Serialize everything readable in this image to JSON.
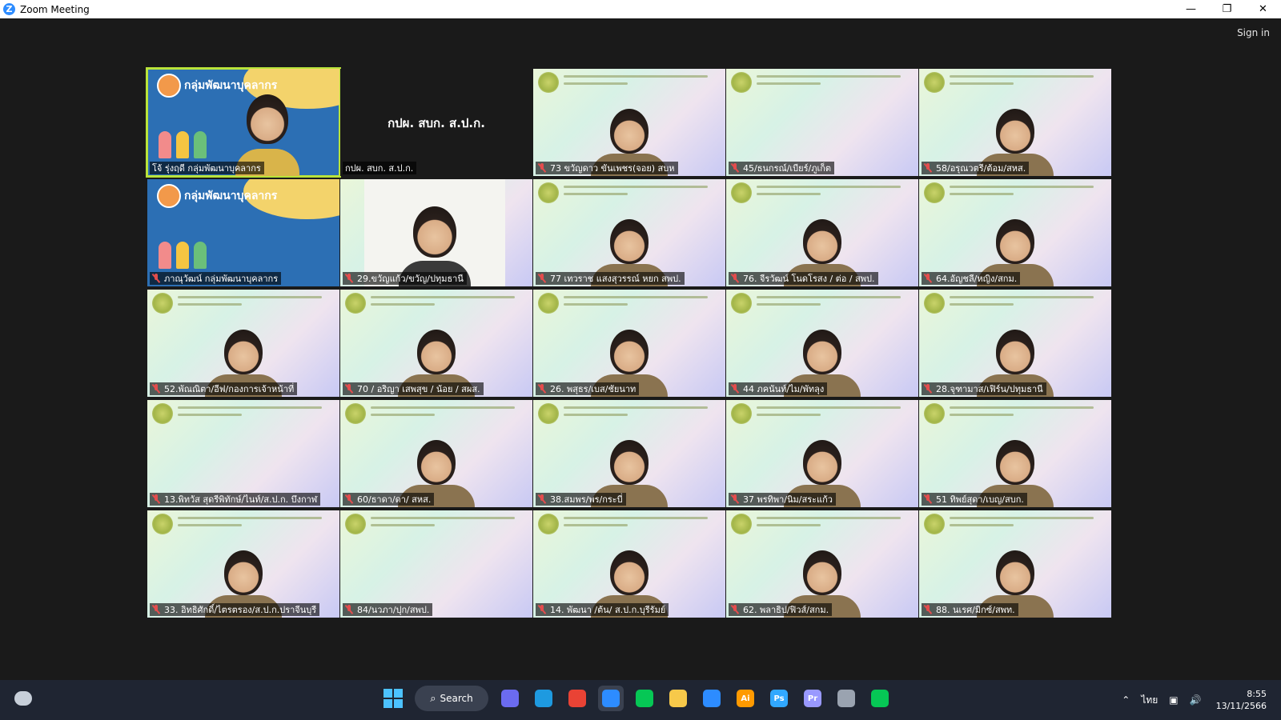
{
  "window": {
    "title": "Zoom Meeting",
    "app_icon": "Z",
    "controls": {
      "minimize": "—",
      "restore": "❐",
      "close": "✕"
    },
    "sign_in": "Sign in"
  },
  "gallery": {
    "tiles": [
      {
        "name": "โจ้ รุ่งฤดี กลุ่มพัฒนาบุคลากร",
        "muted": false,
        "kind": "brand",
        "speaking": true,
        "slide_title": "กลุ่มพัฒนาบุคลากร"
      },
      {
        "name": "กปผ. สบก. ส.ป.ก.",
        "muted": false,
        "kind": "dark",
        "center_text": "กปผ. สบก. ส.ป.ก."
      },
      {
        "name": "73 ขวัญดาว ขันเพชร(จอย) สบห",
        "muted": true,
        "kind": "person"
      },
      {
        "name": "45/ธนกรณ์/เบียร์/ภูเก็ต",
        "muted": true,
        "kind": "slide"
      },
      {
        "name": "58/อรุณวตรี/ต้อม/สหส.",
        "muted": true,
        "kind": "person"
      },
      {
        "name": "ภาณุวัฒน์ กลุ่มพัฒนาบุคลากร",
        "muted": true,
        "kind": "brand",
        "slide_title": "กลุ่มพัฒนาบุคลากร"
      },
      {
        "name": "29.ขวัญแก้ว/ขวัญ/ปทุมธานี",
        "muted": true,
        "kind": "paper"
      },
      {
        "name": "77 เทวราช แสงสุวรรณ์ หยก สพป.",
        "muted": true,
        "kind": "person"
      },
      {
        "name": "76. จีรวัฒน์ โนดโรสง / ต่อ / สพป.",
        "muted": true,
        "kind": "person"
      },
      {
        "name": "64.อัญชลี/หญิง/สกม.",
        "muted": true,
        "kind": "person"
      },
      {
        "name": "52.พัณณิตา/อีฟ/กองการเจ้าหน้าที่",
        "muted": true,
        "kind": "person"
      },
      {
        "name": "70 / อริญา เสพสุข / น้อย / สผส.",
        "muted": true,
        "kind": "person"
      },
      {
        "name": "26. พสุธร/เบส/ชัยนาท",
        "muted": true,
        "kind": "person"
      },
      {
        "name": "44 ภคนันท์/ไม/พัทลุง",
        "muted": true,
        "kind": "person"
      },
      {
        "name": "28.จุฑามาส/เฟิร์น/ปทุมธานี",
        "muted": true,
        "kind": "person"
      },
      {
        "name": "13.พิทวัส สุดรีพิทักษ์/ไนท์/ส.ป.ก. บึงกาฬ",
        "muted": true,
        "kind": "slide"
      },
      {
        "name": "60/ธาดา/ดา/ สหส.",
        "muted": true,
        "kind": "person"
      },
      {
        "name": "38.สมพร/พร/กระบี่",
        "muted": true,
        "kind": "person"
      },
      {
        "name": "37 พรทิพา/นิม/สระแก้ว",
        "muted": true,
        "kind": "person"
      },
      {
        "name": "51 ทิพย์สุดา/เบญ/สบก.",
        "muted": true,
        "kind": "person"
      },
      {
        "name": "33. อิทธิศักดิ์/ไตรตรอง/ส.ป.ก.ปราจีนบุรี",
        "muted": true,
        "kind": "person"
      },
      {
        "name": "84/นวภา/ปุก/สพป.",
        "muted": true,
        "kind": "slide"
      },
      {
        "name": "14. พัฒนา /ต้น/ ส.ป.ก.บุรีรัมย์",
        "muted": true,
        "kind": "person"
      },
      {
        "name": "62. พลาธิป/ฟิวส์/สกม.",
        "muted": true,
        "kind": "person"
      },
      {
        "name": "88. นเรศ/มิกซ์/สพท.",
        "muted": true,
        "kind": "person"
      }
    ]
  },
  "taskbar": {
    "search_label": "Search",
    "apps": [
      {
        "name": "start",
        "icon": "windows-icon"
      },
      {
        "name": "search",
        "icon": "search-icon"
      },
      {
        "name": "meet",
        "icon": "video-icon",
        "color": "#6b6bf0"
      },
      {
        "name": "edge",
        "icon": "edge-icon",
        "color": "#1e9ae0"
      },
      {
        "name": "chrome",
        "icon": "chrome-icon",
        "color": "#e94335",
        "badge": "0"
      },
      {
        "name": "zoom",
        "icon": "zoom-icon",
        "color": "#2d8cff",
        "active": true
      },
      {
        "name": "line",
        "icon": "line-icon",
        "color": "#06c755"
      },
      {
        "name": "files",
        "icon": "folder-icon",
        "color": "#f7c94a"
      },
      {
        "name": "app3",
        "icon": "three-icon",
        "color": "#2d8cff"
      },
      {
        "name": "illustrator",
        "icon": "illustrator-icon",
        "color": "#ff9a00",
        "label": "Ai"
      },
      {
        "name": "photoshop",
        "icon": "photoshop-icon",
        "color": "#31a8ff",
        "label": "Ps"
      },
      {
        "name": "premiere",
        "icon": "premiere-icon",
        "color": "#9999ff",
        "label": "Pr"
      },
      {
        "name": "calculator",
        "icon": "calculator-icon",
        "color": "#9aa3b0"
      },
      {
        "name": "line2",
        "icon": "line-icon",
        "color": "#06c755"
      }
    ],
    "tray": {
      "language": "ไทย",
      "time": "8:55",
      "date": "13/11/2566"
    }
  }
}
